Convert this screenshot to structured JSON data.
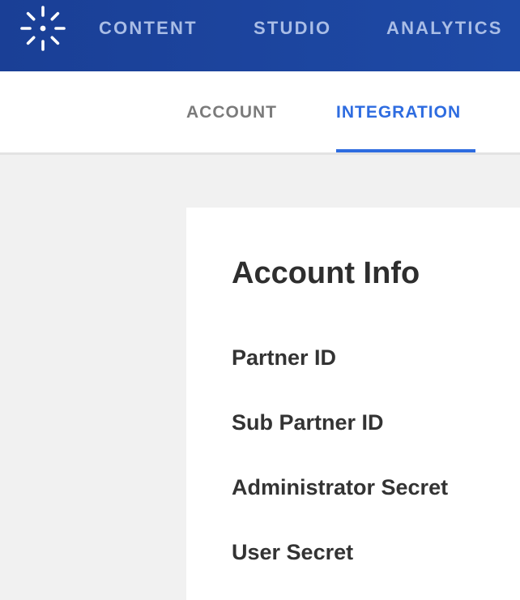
{
  "header": {
    "logo_icon": "spark-logo-icon",
    "nav": [
      "CONTENT",
      "STUDIO",
      "ANALYTICS"
    ]
  },
  "tabs": {
    "items": [
      "ACCOUNT",
      "INTEGRATION"
    ],
    "active": "INTEGRATION"
  },
  "card": {
    "title": "Account Info",
    "fields": [
      "Partner ID",
      "Sub Partner ID",
      "Administrator Secret",
      "User Secret"
    ]
  },
  "colors": {
    "header_bg": "#1e4aa6",
    "nav_text": "#a9bde6",
    "active_tab": "#2e6ce0",
    "inactive_tab": "#7b7b7b",
    "page_bg": "#f1f1f1"
  }
}
